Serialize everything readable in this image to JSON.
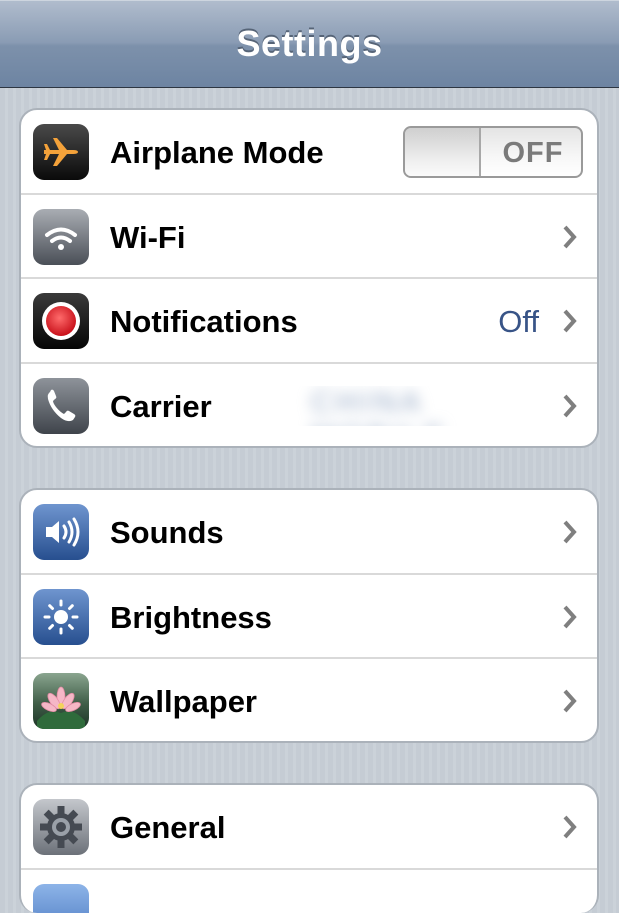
{
  "navbar": {
    "title": "Settings"
  },
  "groups": [
    {
      "rows": [
        {
          "label": "Airplane Mode",
          "icon": "airplane-icon",
          "toggle": "OFF"
        },
        {
          "label": "Wi-Fi",
          "icon": "wifi-icon"
        },
        {
          "label": "Notifications",
          "icon": "notifications-icon",
          "value": "Off"
        },
        {
          "label": "Carrier",
          "icon": "phone-icon",
          "value": "CHINA MOBILE"
        }
      ]
    },
    {
      "rows": [
        {
          "label": "Sounds",
          "icon": "speaker-icon"
        },
        {
          "label": "Brightness",
          "icon": "sun-icon"
        },
        {
          "label": "Wallpaper",
          "icon": "flower-icon"
        }
      ]
    },
    {
      "rows": [
        {
          "label": "General",
          "icon": "gear-icon"
        }
      ]
    }
  ],
  "colors": {
    "nav_gradient_top": "#b0bccd",
    "nav_gradient_bottom": "#6d84a2",
    "background": "#c5ccd4",
    "value_text": "#385487",
    "airplane_orange": "#f4a23a",
    "notification_red": "#e3262e",
    "sounds_blue": "#3a67a8"
  }
}
